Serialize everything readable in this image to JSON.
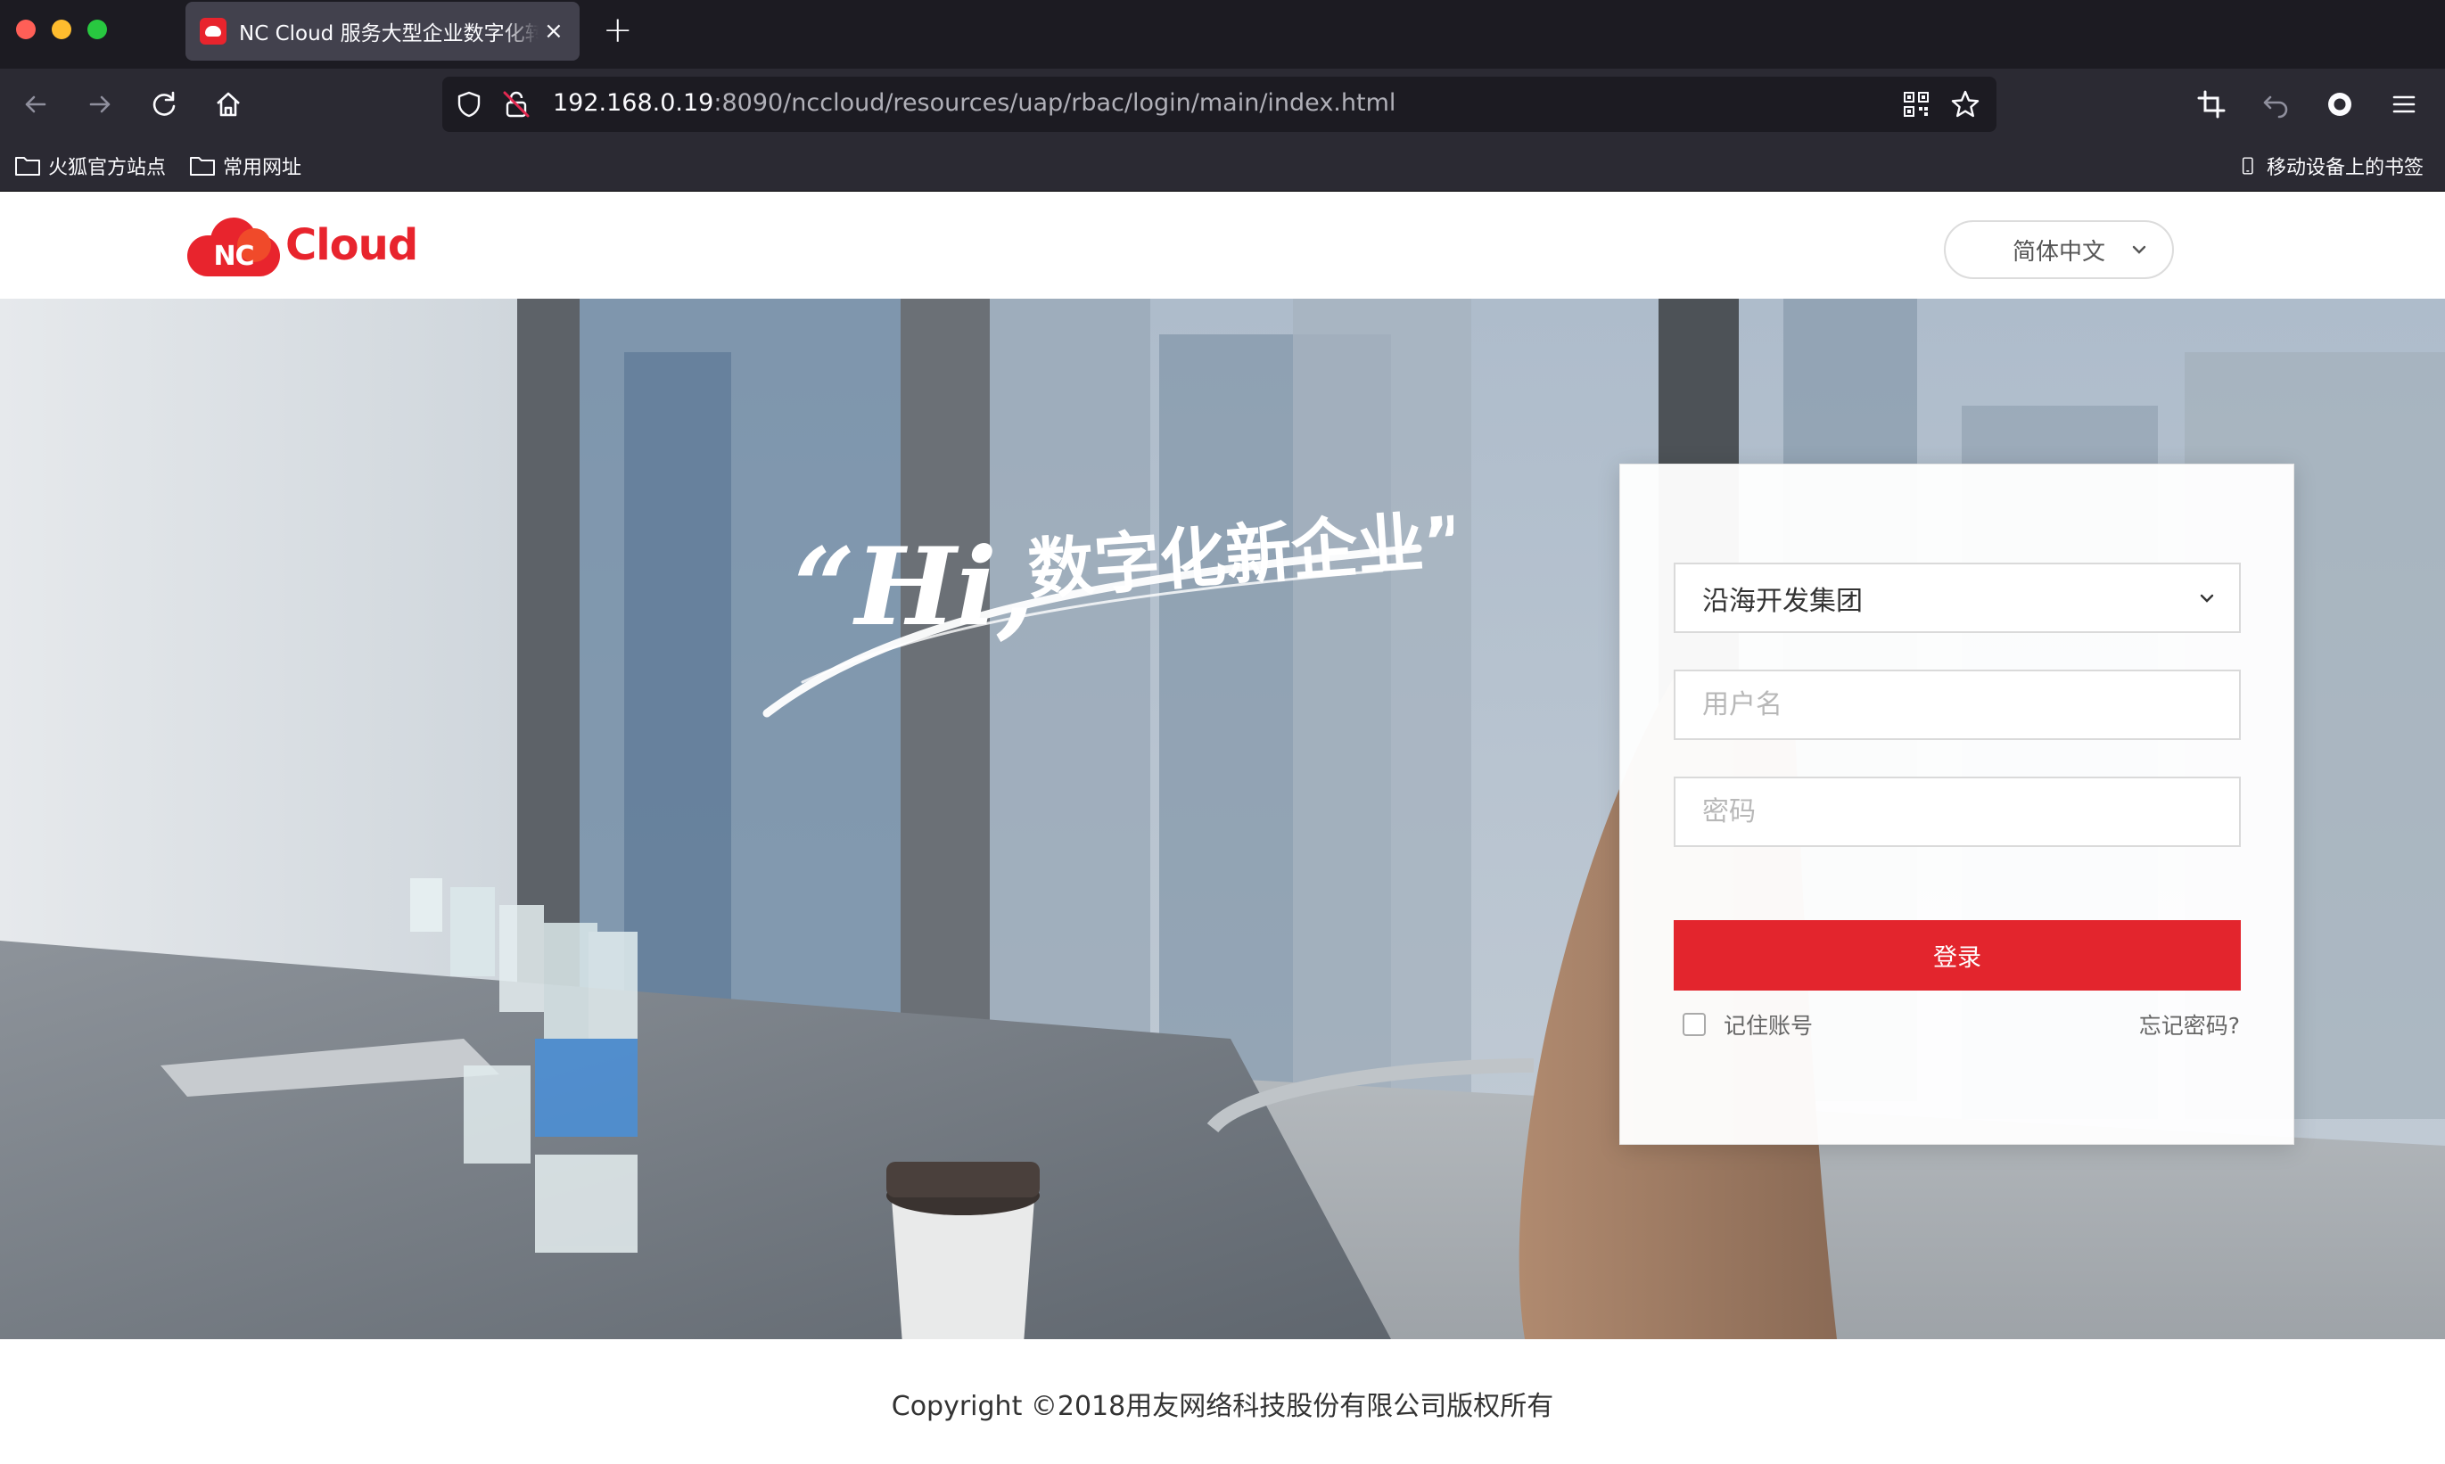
{
  "browser": {
    "tab": {
      "title": "NC Cloud 服务大型企业数字化转型"
    },
    "url": {
      "host": "192.168.0.19",
      "rest": ":8090/nccloud/resources/uap/rbac/login/main/index.html"
    },
    "bookmarks": [
      {
        "label": "火狐官方站点"
      },
      {
        "label": "常用网址"
      }
    ],
    "mobile_bookmarks": "移动设备上的书签"
  },
  "header": {
    "logo": {
      "nc": "NC",
      "cloud": "Cloud"
    },
    "language": "简体中文"
  },
  "hero": {
    "slogan_latin": "“Hi,",
    "slogan_cn": "数字化新企业”"
  },
  "login": {
    "organization": "沿海开发集团",
    "username_placeholder": "用户名",
    "password_placeholder": "密码",
    "submit_label": "登录",
    "remember_label": "记住账号",
    "forgot_label": "忘记密码?"
  },
  "footer": {
    "copyright": "Copyright ©2018用友网络科技股份有限公司版权所有"
  },
  "colors": {
    "brand_red": "#e3252d",
    "browser_dark": "#1c1b22",
    "browser_toolbar": "#2b2a33"
  }
}
